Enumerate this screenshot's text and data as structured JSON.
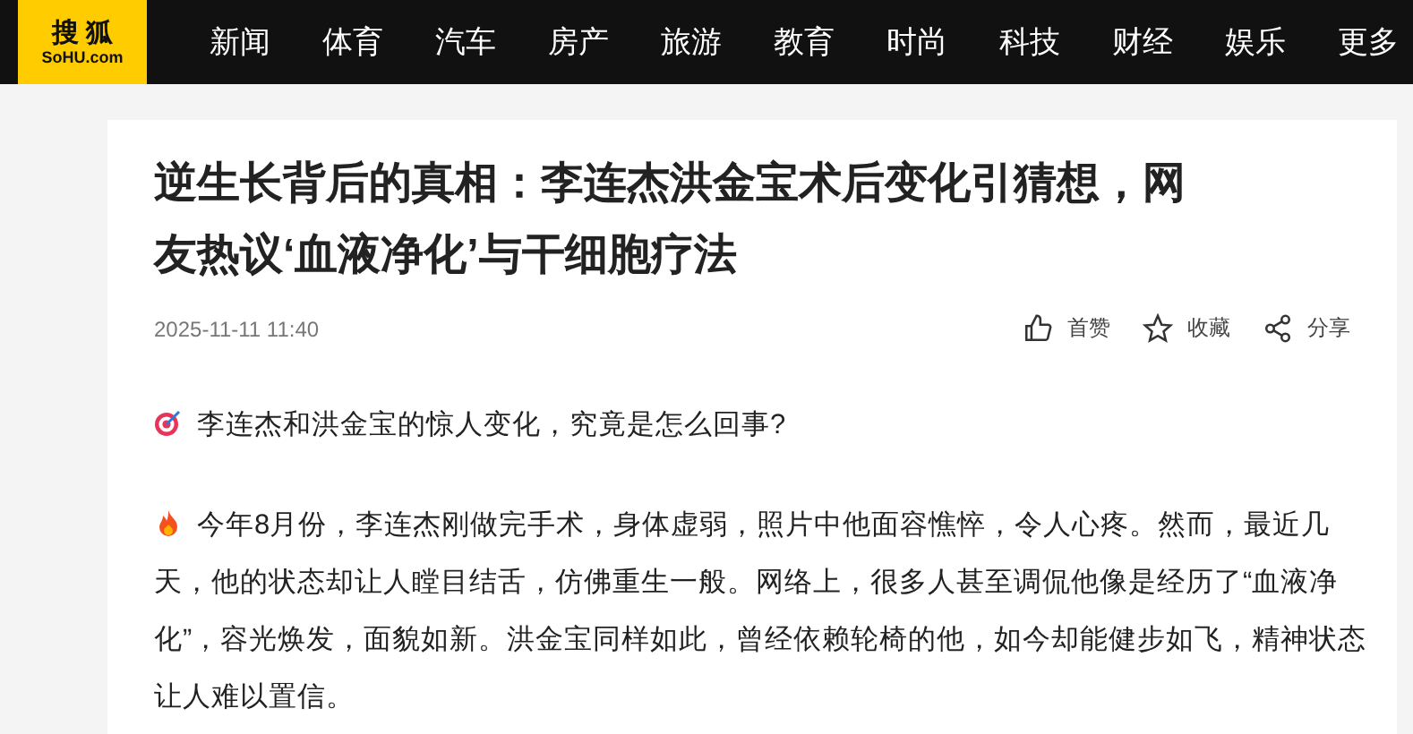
{
  "logo": {
    "name": "搜 狐",
    "domain": "SoHU.com"
  },
  "nav": [
    "新闻",
    "体育",
    "汽车",
    "房产",
    "旅游",
    "教育",
    "时尚",
    "科技",
    "财经",
    "娱乐",
    "更多"
  ],
  "article": {
    "title": "逆生长背后的真相：李连杰洪金宝术后变化引猜想，网友热议‘血液净化’与干细胞疗法",
    "date": "2025-11-11 11:40",
    "actions": [
      {
        "kind": "like",
        "label": "首赞"
      },
      {
        "kind": "star",
        "label": "收藏"
      },
      {
        "kind": "share",
        "label": "分享"
      }
    ],
    "paragraphs": [
      {
        "kind": "target",
        "text": "李连杰和洪金宝的惊人变化，究竟是怎么回事?"
      },
      {
        "kind": "fire",
        "text": "今年8月份，李连杰刚做完手术，身体虚弱，照片中他面容憔悴，令人心疼。然而，最近几天，他的状态却让人瞠目结舌，仿佛重生一般。网络上，很多人甚至调侃他像是经历了“血液净化”，容光焕发，面貌如新。洪金宝同样如此，曾经依赖轮椅的他，如今却能健步如飞，精神状态让人难以置信。"
      }
    ]
  }
}
